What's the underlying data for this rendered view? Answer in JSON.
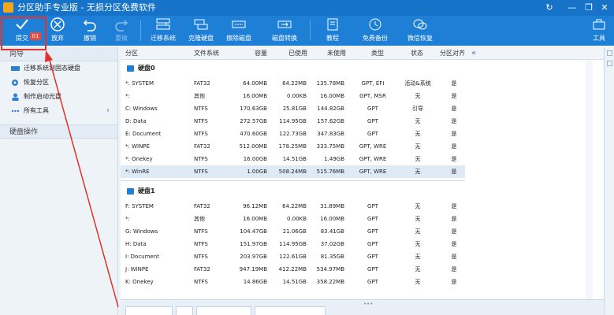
{
  "window": {
    "title": "分区助手专业版 - 无损分区免费软件",
    "controls": [
      "↻",
      "—",
      "❐",
      "✕"
    ]
  },
  "toolbar": {
    "commit": {
      "label": "提交",
      "badge": "01"
    },
    "discard": "放弃",
    "undo": "撤销",
    "redo": "重做",
    "migrate": "迁移系统",
    "clone": "克隆硬盘",
    "wipe": "擦除磁盘",
    "convert": "磁盘转换",
    "tutorial": "教程",
    "backup": "免费备份",
    "restore": "微信恢复",
    "tools": "工具"
  },
  "sidebar": {
    "wizard_title": "向导",
    "items": [
      {
        "label": "迁移系统到固态硬盘",
        "icon": "disk-migrate-icon"
      },
      {
        "label": "恢复分区",
        "icon": "recover-icon"
      },
      {
        "label": "制作启动光盘",
        "icon": "boot-cd-icon"
      },
      {
        "label": "所有工具",
        "icon": "more-dots-icon",
        "chevron": "›"
      }
    ],
    "disk_ops_title": "硬盘操作"
  },
  "table": {
    "headers": [
      "分区",
      "文件系统",
      "容量",
      "已使用",
      "未使用",
      "类型",
      "状态",
      "分区对齐"
    ],
    "collapse_glyph": "«",
    "disks": [
      {
        "name": "硬盘0",
        "partitions": [
          [
            "*: SYSTEM",
            "FAT32",
            "64.00MB",
            "64.22MB",
            "135.78MB",
            "GPT, EFI",
            "活动&系统",
            "是"
          ],
          [
            "*:",
            "其他",
            "16.00MB",
            "0.00KB",
            "16.00MB",
            "GPT, MSR",
            "无",
            "是"
          ],
          [
            "C: Windows",
            "NTFS",
            "170.63GB",
            "25.81GB",
            "144.82GB",
            "GPT",
            "引导",
            "是"
          ],
          [
            "D: Data",
            "NTFS",
            "272.57GB",
            "114.95GB",
            "157.62GB",
            "GPT",
            "无",
            "是"
          ],
          [
            "E: Document",
            "NTFS",
            "470.60GB",
            "122.73GB",
            "347.83GB",
            "GPT",
            "无",
            "是"
          ],
          [
            "*: WINPE",
            "FAT32",
            "512.00MB",
            "178.25MB",
            "333.75MB",
            "GPT, WRE",
            "无",
            "是"
          ],
          [
            "*: Onekey",
            "NTFS",
            "16.00GB",
            "14.51GB",
            "1.49GB",
            "GPT, WRE",
            "无",
            "是"
          ],
          [
            "*: WinRE",
            "NTFS",
            "1.00GB",
            "508.24MB",
            "515.76MB",
            "GPT, WRE",
            "无",
            "是"
          ]
        ]
      },
      {
        "name": "硬盘1",
        "partitions": [
          [
            "F: SYSTEM",
            "FAT32",
            "96.12MB",
            "64.22MB",
            "31.89MB",
            "GPT",
            "无",
            "是"
          ],
          [
            "*:",
            "其他",
            "16.00MB",
            "0.00KB",
            "16.00MB",
            "GPT",
            "无",
            "是"
          ],
          [
            "G: Windows",
            "NTFS",
            "104.47GB",
            "21.06GB",
            "83.41GB",
            "GPT",
            "无",
            "是"
          ],
          [
            "H: Data",
            "NTFS",
            "151.97GB",
            "114.95GB",
            "37.02GB",
            "GPT",
            "无",
            "是"
          ],
          [
            "I: Document",
            "NTFS",
            "203.97GB",
            "122.61GB",
            "81.35GB",
            "GPT",
            "无",
            "是"
          ],
          [
            "J: WINPE",
            "FAT32",
            "947.19MB",
            "412.22MB",
            "534.97MB",
            "GPT",
            "无",
            "是"
          ],
          [
            "K: Onekey",
            "NTFS",
            "14.86GB",
            "14.51GB",
            "358.22MB",
            "GPT",
            "无",
            "是"
          ]
        ]
      }
    ]
  },
  "colors": {
    "titlebar": "#1673c8",
    "toolbar": "#1e7fd6",
    "annotation_red": "#e0322b",
    "selected_row": "#dfeaf7"
  }
}
